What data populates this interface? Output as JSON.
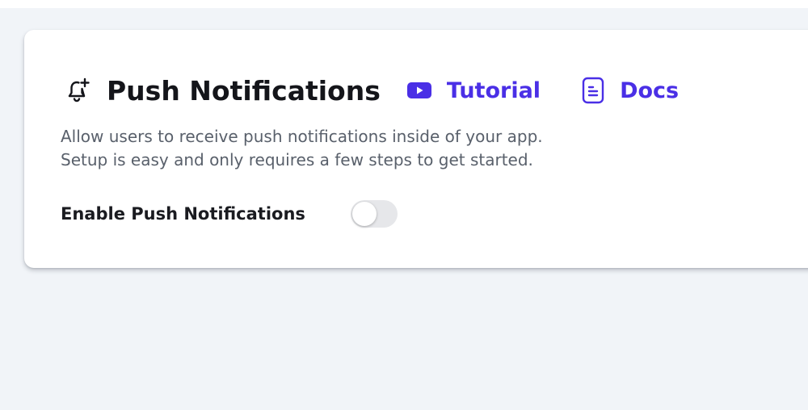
{
  "card": {
    "icon": "bell-plus-icon",
    "title": "Push Notifications",
    "links": {
      "tutorial": {
        "label": "Tutorial",
        "icon": "youtube-play-icon"
      },
      "docs": {
        "label": "Docs",
        "icon": "document-icon"
      }
    },
    "description": {
      "line1": "Allow users to receive push notifications inside of your app.",
      "line2": "Setup is easy and only requires a few steps to get started."
    },
    "toggle": {
      "label": "Enable Push Notifications",
      "enabled": false
    }
  },
  "colors": {
    "accent": "#4a2fe6",
    "page_background": "#f1f4f8",
    "card_background": "#ffffff",
    "title": "#14151a",
    "description": "#59606b",
    "toggle_off": "#e6e7ea"
  }
}
